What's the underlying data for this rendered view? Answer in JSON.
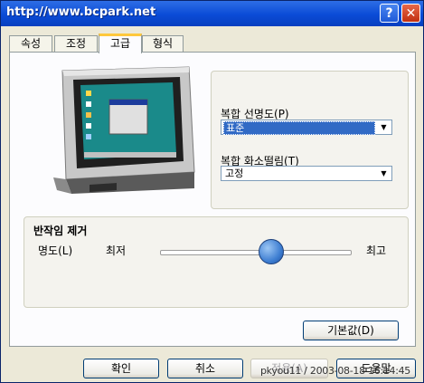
{
  "titlebar": {
    "title": "http://www.bcpark.net",
    "help_label": "?",
    "close_label": "✕"
  },
  "tabs": [
    {
      "label": "속성",
      "active": false
    },
    {
      "label": "조정",
      "active": false
    },
    {
      "label": "고급",
      "active": true
    },
    {
      "label": "형식",
      "active": false
    }
  ],
  "settings": {
    "sharpness_label": "복합 선명도(P)",
    "sharpness_value": "표준",
    "flicker_label": "복합 화소떨림(T)",
    "flicker_value": "고정"
  },
  "flicker_group": {
    "title": "반작임 제거",
    "brightness_label": "명도(L)",
    "min_label": "최저",
    "max_label": "최고",
    "level_fraction": 0.5
  },
  "buttons": {
    "defaults": "기본값(D)",
    "ok": "확인",
    "cancel": "취소",
    "apply": "적용(A)",
    "help": "도움말"
  },
  "watermark": "pkyou11 / 2003-08-18 16:14:45",
  "icons": {
    "help": "help-icon",
    "close": "close-icon",
    "monitor": "tv-monitor-icon",
    "dropdown": "chevron-down-icon"
  },
  "colors": {
    "titlebar": "#0a4bd6",
    "selection": "#316ac5",
    "active_tab_accent": "#ffc83c",
    "window_bg": "#ece9d8"
  }
}
